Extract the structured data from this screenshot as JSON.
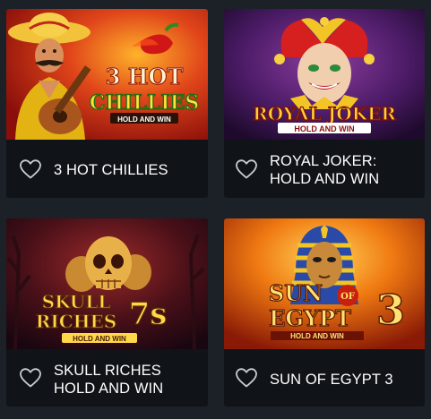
{
  "games": [
    {
      "title_line1": "3 HOT CHILLIES",
      "title_line2": "",
      "art_logo_top": "3 HOT",
      "art_logo_main": "CHILLIES",
      "art_logo_sub": "HOLD AND WIN"
    },
    {
      "title_line1": "ROYAL JOKER:",
      "title_line2": "HOLD AND WIN",
      "art_logo_main": "ROYAL JOKER",
      "art_logo_sub": "HOLD AND WIN"
    },
    {
      "title_line1": "SKULL RICHES",
      "title_line2": "HOLD AND WIN",
      "art_logo_top": "SKULL",
      "art_logo_main": "RICHES",
      "art_logo_num": "7s",
      "art_logo_sub": "HOLD AND WIN"
    },
    {
      "title_line1": "SUN OF EGYPT 3",
      "title_line2": "",
      "art_logo_top": "SUN",
      "art_logo_of": "OF",
      "art_logo_main": "EGYPT",
      "art_logo_num": "3",
      "art_logo_sub": "HOLD AND WIN"
    }
  ],
  "icons": {
    "favorite": "heart-outline-icon"
  },
  "colors": {
    "card_bg": "#101318",
    "page_bg": "#1c2027",
    "title": "#ffffff",
    "heart": "#c9ccd1"
  }
}
